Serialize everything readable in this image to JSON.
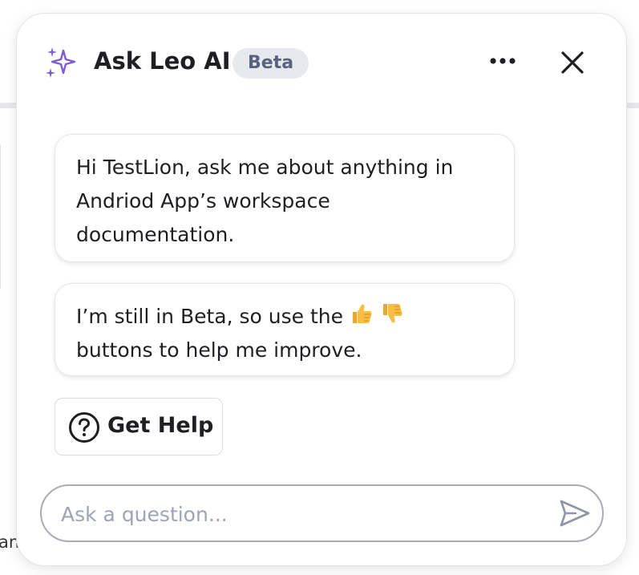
{
  "header": {
    "title": "Ask Leo AI",
    "badge": "Beta",
    "sparkle_icon": "sparkle-icon",
    "more_icon": "more-horizontal-icon",
    "close_icon": "close-icon",
    "accent_color": "#7c5cd6"
  },
  "messages": [
    {
      "lines": [
        "Hi TestLion, ask me about anything in",
        "Andriod App’s workspace",
        "documentation."
      ]
    },
    {
      "line1_text": "I’m still in Beta, so use the",
      "line1_icons": [
        "thumbs-up-icon",
        "thumbs-down-icon"
      ],
      "line2": "buttons to help me improve."
    }
  ],
  "help_button": {
    "label": "Get Help",
    "icon": "question-circle-icon"
  },
  "input": {
    "placeholder": "Ask a question...",
    "value": "",
    "send_icon": "send-icon"
  },
  "background": {
    "partial_text": "an"
  }
}
